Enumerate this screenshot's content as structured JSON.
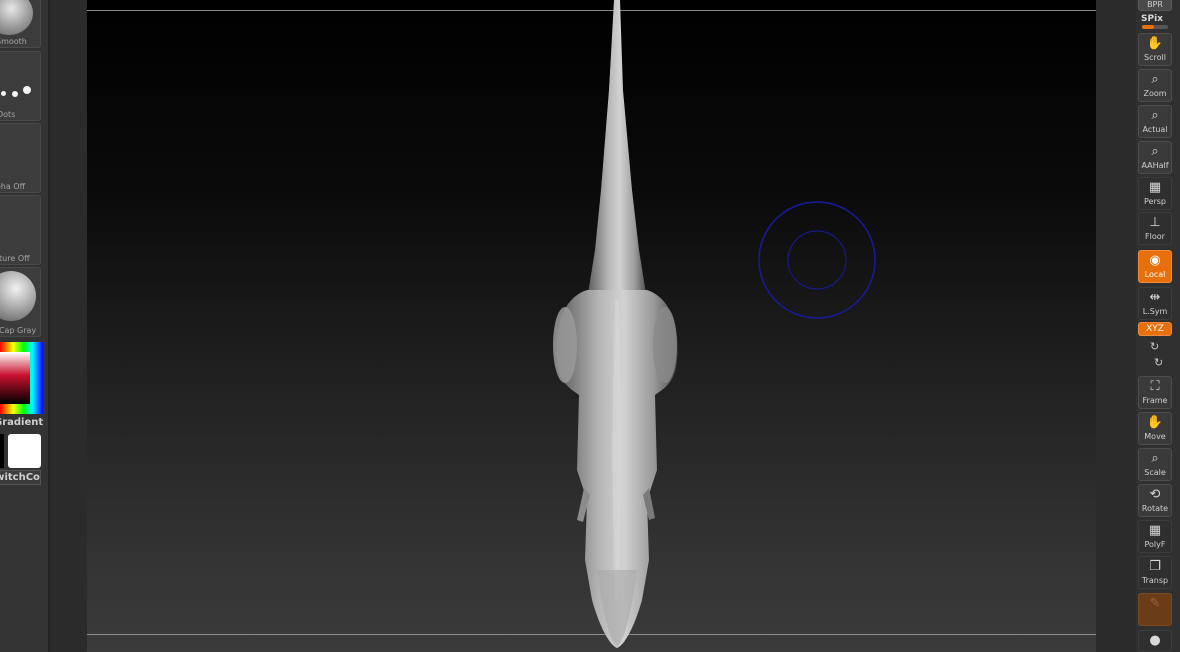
{
  "left_shelf": {
    "brush": "Smooth",
    "stroke": "Dots",
    "alpha": "Alpha Off",
    "texture": "Texture Off",
    "material": "MatCap Gray",
    "gradient": "Gradient",
    "switch_color": "SwitchColor"
  },
  "right_shelf": {
    "bpr": "BPR",
    "spix": "SPix",
    "buttons": [
      {
        "label": "Scroll",
        "icon": "hand-icon"
      },
      {
        "label": "Zoom",
        "icon": "magnifier-icon"
      },
      {
        "label": "Actual",
        "icon": "magnifier-icon"
      },
      {
        "label": "AAHalf",
        "icon": "magnifier-icon"
      },
      {
        "label": "Persp",
        "icon": "grid-icon"
      },
      {
        "label": "Floor",
        "icon": "floor-icon"
      },
      {
        "label": "Local",
        "icon": "local-icon",
        "active": true
      },
      {
        "label": "L.Sym",
        "icon": "symmetry-icon"
      },
      {
        "label": "Frame",
        "icon": "frame-icon"
      },
      {
        "label": "Move",
        "icon": "hand-icon"
      },
      {
        "label": "Scale",
        "icon": "magnifier-icon"
      },
      {
        "label": "Rotate",
        "icon": "rotate-icon"
      },
      {
        "label": "PolyF",
        "icon": "polyframe-icon"
      },
      {
        "label": "Transp",
        "icon": "transparency-icon"
      }
    ],
    "xyz_label": "XYZ",
    "colors": {
      "accent": "#e8700c"
    }
  },
  "viewport": {
    "cursor_color": "#1a1aa0"
  }
}
